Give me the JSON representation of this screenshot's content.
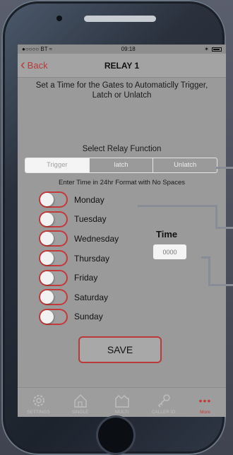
{
  "status_bar": {
    "carrier": "●○○○○ BT ≈",
    "time": "09:18"
  },
  "nav": {
    "back_label": "Back",
    "title": "RELAY 1"
  },
  "instruction": "Set a Time for the Gates to Automaticlly Trigger, Latch or Unlatch",
  "relay_function": {
    "label": "Select Relay Function",
    "options": [
      "Trigger",
      "latch",
      "Unlatch"
    ],
    "selected": "Trigger"
  },
  "format_hint": "Enter Time in 24hr Format with No Spaces",
  "days": [
    {
      "label": "Monday",
      "on": false
    },
    {
      "label": "Tuesday",
      "on": false
    },
    {
      "label": "Wednesday",
      "on": false
    },
    {
      "label": "Thursday",
      "on": false
    },
    {
      "label": "Friday",
      "on": false
    },
    {
      "label": "Saturday",
      "on": false
    },
    {
      "label": "Sunday",
      "on": false
    }
  ],
  "time": {
    "label": "Time",
    "placeholder": "0000",
    "value": ""
  },
  "save_label": "SAVE",
  "tabs": [
    {
      "label": "SETTINGS",
      "icon": "gear-icon"
    },
    {
      "label": "SINGLE",
      "icon": "house-icon"
    },
    {
      "label": "MULTI",
      "icon": "building-icon"
    },
    {
      "label": "CALLER ID",
      "icon": "key-icon"
    },
    {
      "label": "More",
      "icon": "more-dots-icon"
    }
  ],
  "colors": {
    "accent": "#c43a3a",
    "background": "#9a9a9a"
  }
}
